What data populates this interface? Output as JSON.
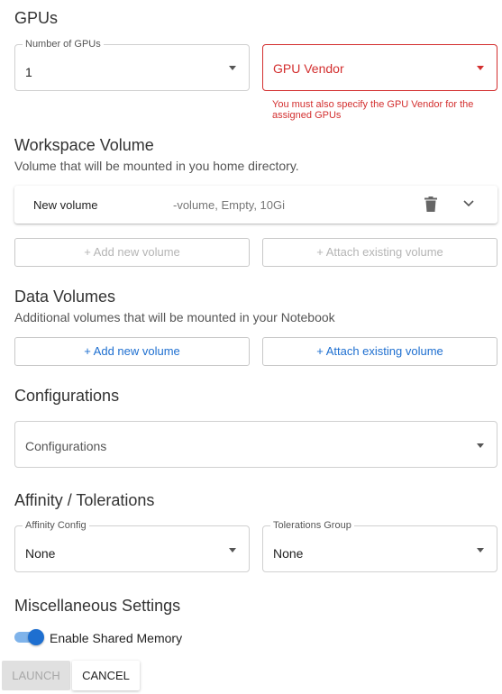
{
  "gpus": {
    "title": "GPUs",
    "number_label": "Number of GPUs",
    "number_value": "1",
    "vendor_placeholder": "GPU Vendor",
    "vendor_error_line1": "You must also specify the GPU Vendor for the",
    "vendor_error_line2": "assigned GPUs"
  },
  "workspace": {
    "title": "Workspace Volume",
    "subtitle": "Volume that will be mounted in you home directory.",
    "volume_name": "New volume",
    "volume_desc": "-volume, Empty, 10Gi",
    "add_new_label": "+ Add new volume",
    "attach_label": "+ Attach existing volume"
  },
  "data_volumes": {
    "title": "Data Volumes",
    "subtitle": "Additional volumes that will be mounted in your Notebook",
    "add_new_label": "+ Add new volume",
    "attach_label": "+ Attach existing volume"
  },
  "configurations": {
    "title": "Configurations",
    "placeholder": "Configurations"
  },
  "affinity": {
    "title": "Affinity / Tolerations",
    "affinity_label": "Affinity Config",
    "affinity_value": "None",
    "tolerations_label": "Tolerations Group",
    "tolerations_value": "None"
  },
  "misc": {
    "title": "Miscellaneous Settings",
    "shared_memory_label": "Enable Shared Memory",
    "shared_memory_enabled": true
  },
  "actions": {
    "launch_label": "LAUNCH",
    "cancel_label": "CANCEL"
  },
  "colors": {
    "accent": "#1e6fd0",
    "error": "#d32f2f"
  },
  "icons": {
    "volume_delete": "trash-icon",
    "volume_expand": "chevron-down-icon",
    "select_arrow": "caret-down-icon"
  }
}
